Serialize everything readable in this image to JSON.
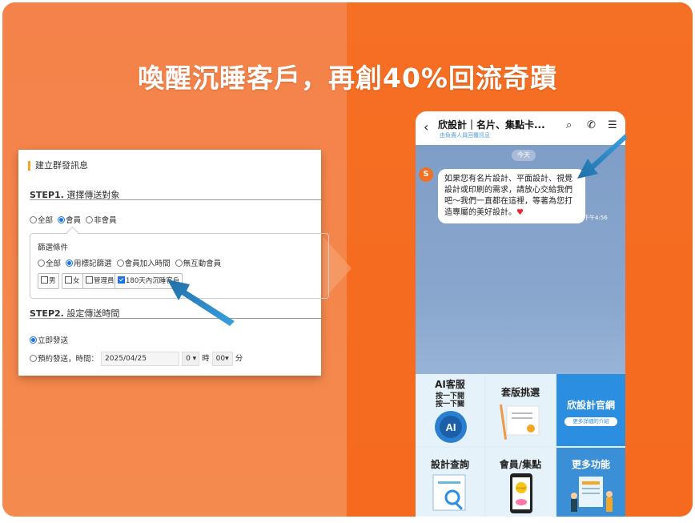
{
  "headline": "喚醒沉睡客戶，再創40%回流奇蹟",
  "form": {
    "title": "建立群發訊息",
    "step1": {
      "num": "STEP1.",
      "label": "選擇傳送對象"
    },
    "audience": [
      "全部",
      "會員",
      "非會員"
    ],
    "filter_title": "篩選條件",
    "filters": [
      "全部",
      "用標記篩選",
      "會員加入時間",
      "無互動會員"
    ],
    "tags": [
      "男",
      "女",
      "管理員",
      "180天內沉睡客戶"
    ],
    "step2": {
      "num": "STEP2.",
      "label": "設定傳送時間"
    },
    "send_now": "立即發送",
    "schedule_label": "預約發送，時間：",
    "schedule_date": "2025/04/25",
    "hour": "0",
    "hour_unit": "時",
    "minute": "00",
    "minute_unit": "分"
  },
  "phone": {
    "title": "欣設計｜名片、集點卡...",
    "subtitle": "由負責人員回覆訊息",
    "date_chip": "今天",
    "message": "如果您有名片設計、平面設計、視覺設計或印刷的需求，請放心交給我們吧～我們一直都在這裡，等著為您打造專屬的美好設計。",
    "time": "下午4:56",
    "menu": {
      "ai": {
        "label": "AI客服",
        "sub1": "按一下開",
        "sub2": "按一下關",
        "badge": "AI"
      },
      "template": {
        "label": "套版挑選"
      },
      "website": {
        "label": "欣設計官網",
        "pill": "更多詳細的介紹"
      },
      "query": {
        "label": "設計查詢"
      },
      "member": {
        "label": "會員/集點",
        "coin": "POINT"
      },
      "more": {
        "label": "更多功能"
      }
    }
  },
  "colors": {
    "orange": "#f56f24",
    "blue_accent": "#1a73e8",
    "arrow": "#1f7ab8"
  }
}
